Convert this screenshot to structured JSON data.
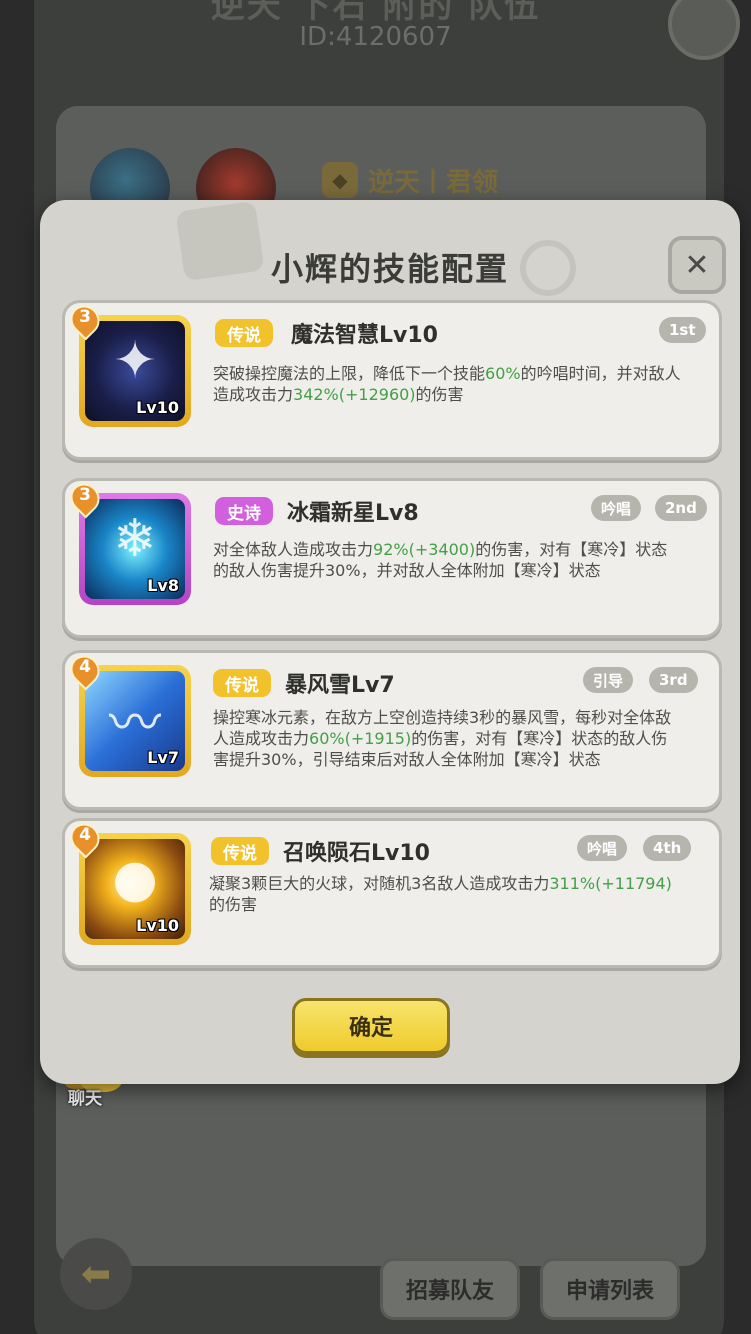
{
  "background": {
    "title": "逆天 下石 附的 队伍",
    "player_id": "ID:4120607",
    "guild_label": "逆天丨君领",
    "recruit_button": "招募队友",
    "apply_list_button": "申请列表",
    "chat_label": "聊天"
  },
  "modal": {
    "title": "小辉的技能配置",
    "close_symbol": "✕",
    "confirm_button": "确定",
    "skills": [
      {
        "rank": "3",
        "rarity": "传说",
        "name": "魔法智慧Lv10",
        "level_label": "Lv10",
        "tags": [],
        "order": "1st",
        "icon": "magic-star-icon",
        "desc_parts": [
          "突破操控魔法的上限，降低下一个技能",
          "60%",
          "的吟唱时间，并对敌人造成攻击力",
          "342%(+12960)",
          "的伤害"
        ]
      },
      {
        "rank": "3",
        "rarity": "史诗",
        "name": "冰霜新星Lv8",
        "level_label": "Lv8",
        "tags": [
          "吟唱"
        ],
        "order": "2nd",
        "icon": "frost-nova-icon",
        "desc_parts": [
          "对全体敌人造成攻击力",
          "92%(+3400)",
          "的伤害，对有【寒冷】状态的敌人伤害提升30%，并对敌人全体附加【寒冷】状态",
          "",
          ""
        ]
      },
      {
        "rank": "4",
        "rarity": "传说",
        "name": "暴风雪Lv7",
        "level_label": "Lv7",
        "tags": [
          "引导"
        ],
        "order": "3rd",
        "icon": "blizzard-icon",
        "desc_parts": [
          "操控寒冰元素，在敌方上空创造持续3秒的暴风雪，每秒对全体敌人造成攻击力",
          "60%(+1915)",
          "的伤害，对有【寒冷】状态的敌人伤害提升30%，引导结束后对敌人全体附加【寒冷】状态",
          "",
          ""
        ]
      },
      {
        "rank": "4",
        "rarity": "传说",
        "name": "召唤陨石Lv10",
        "level_label": "Lv10",
        "tags": [
          "吟唱"
        ],
        "order": "4th",
        "icon": "meteor-icon",
        "desc_parts": [
          "凝聚3颗巨大的火球，对随机3名敌人造成攻击力",
          "311%(+11794)",
          "的伤害",
          "",
          ""
        ]
      }
    ]
  },
  "colors": {
    "legend": "#f2c22c",
    "epic": "#d25fde",
    "highlight": "#43a046"
  }
}
